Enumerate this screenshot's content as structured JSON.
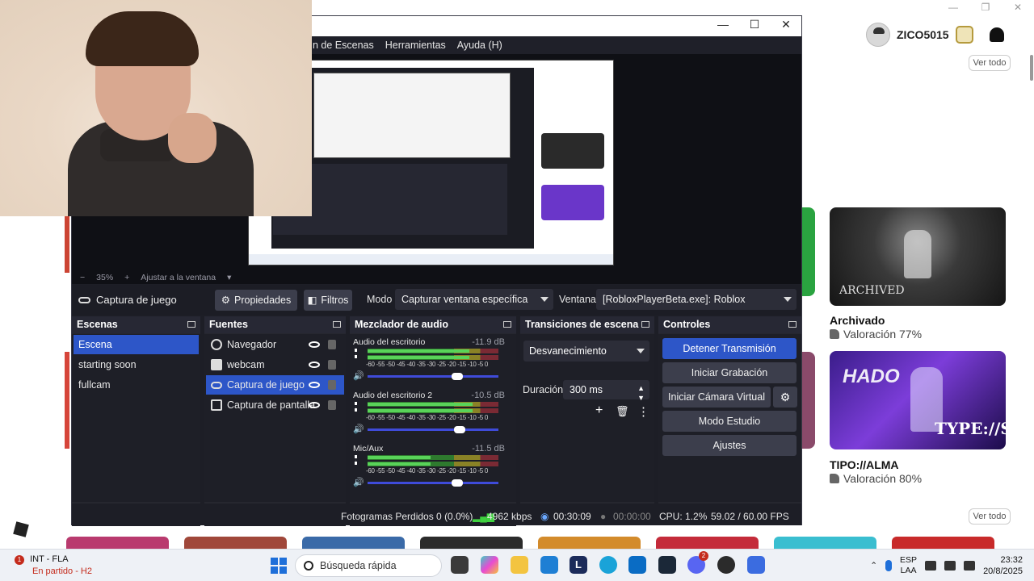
{
  "background": {
    "profile": {
      "username": "ZICO5015"
    },
    "see_all_label": "Ver todo",
    "games": [
      {
        "title": "Archivado",
        "rating": "Valoración 77%",
        "image_logo": "ARCHIVED"
      },
      {
        "title": "TIPO://ALMA",
        "rating": "Valoración 80%",
        "image_text_top": "HADO",
        "image_text_bottom": "TYPE://SOUL"
      }
    ]
  },
  "obs": {
    "menu": [
      "n de Escenas",
      "Herramientas",
      "Ayuda (H)"
    ],
    "zoom": {
      "minus": "−",
      "value": "35%",
      "plus": "+",
      "fit": "Ajustar a la ventana"
    },
    "source_toolbar": {
      "source_name": "Captura de juego",
      "properties": "Propiedades",
      "filters": "Filtros",
      "mode_label": "Modo",
      "mode_value": "Capturar ventana específica",
      "window_label": "Ventana",
      "window_value": "[RobloxPlayerBeta.exe]: Roblox"
    },
    "docks": {
      "scenes": {
        "title": "Escenas",
        "items": [
          "Escena",
          "starting soon",
          "fullcam"
        ],
        "selected": 0
      },
      "sources": {
        "title": "Fuentes",
        "items": [
          "Navegador",
          "webcam",
          "Captura de juego",
          "Captura de pantalla"
        ],
        "selected": 2
      },
      "mixer": {
        "title": "Mezclador de audio",
        "scale": "-60 -55 -50 -45 -40 -35 -30 -25 -20 -15 -10 -5 0",
        "channels": [
          {
            "name": "Audio del escritorio",
            "db": "-11.9 dB",
            "level": 0.78,
            "volume": 0.7
          },
          {
            "name": "Audio del escritorio 2",
            "db": "-10.5 dB",
            "level": 0.8,
            "volume": 0.72
          },
          {
            "name": "Mic/Aux",
            "db": "-11.5 dB",
            "level": 0.48,
            "volume": 0.7
          }
        ]
      },
      "transitions": {
        "title": "Transiciones de escena",
        "type": "Desvanecimiento",
        "duration_label": "Duración",
        "duration_value": "300 ms"
      },
      "controls": {
        "title": "Controles",
        "stop_stream": "Detener Transmisión",
        "start_recording": "Iniciar Grabación",
        "start_virtual_cam": "Iniciar Cámara Virtual",
        "studio_mode": "Modo Estudio",
        "settings": "Ajustes"
      }
    },
    "status": {
      "dropped_frames": "Fotogramas Perdidos 0 (0.0%)",
      "bitrate": "4962 kbps",
      "stream_time": "00:30:09",
      "rec_time": "00:00:00",
      "cpu": "CPU: 1.2%",
      "fps": "59.02 / 60.00 FPS"
    }
  },
  "taskbar": {
    "weather_badge": "1",
    "weather_title": "INT - FLA",
    "weather_sub": "En partido - H2",
    "search_placeholder": "Búsqueda rápida",
    "lang_top": "ESP",
    "lang_bottom": "LAA",
    "time": "23:32",
    "date": "20/8/2025",
    "notification_badge": "2"
  },
  "colors": {
    "accent": "#2d56c8",
    "obs_bg": "#1d1e26",
    "dock_bg": "#1e1f27"
  }
}
